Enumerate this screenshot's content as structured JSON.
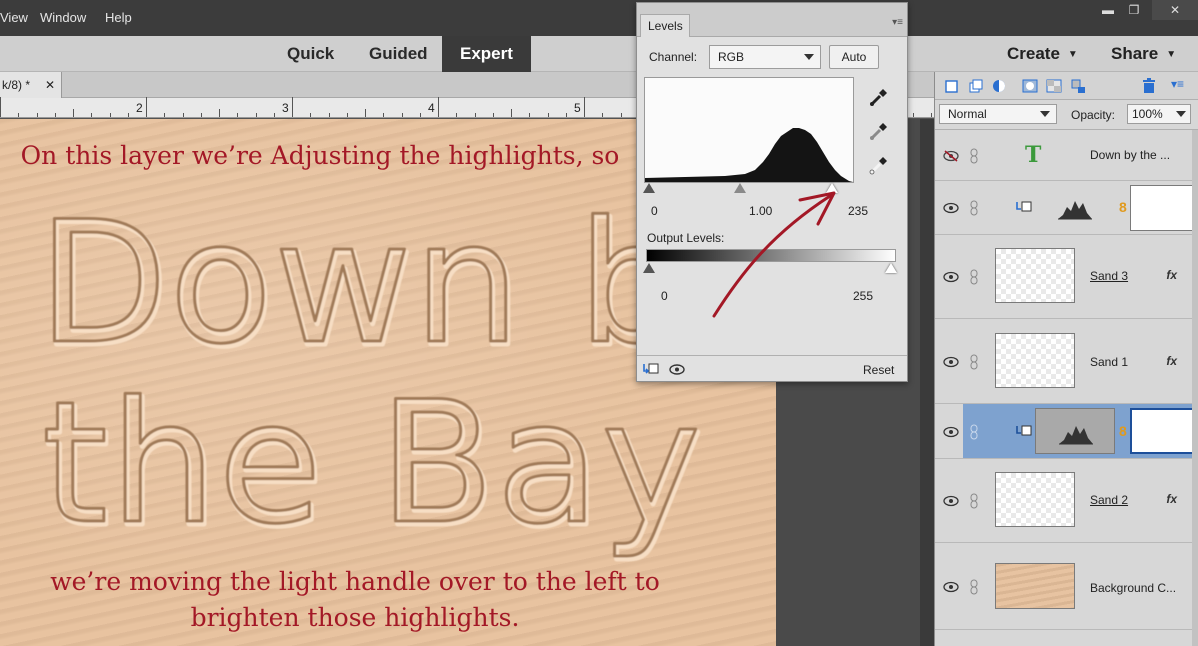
{
  "menu": {
    "items": [
      "View",
      "Window",
      "Help"
    ]
  },
  "window_controls": {
    "minimize": "▬",
    "restore": "❐",
    "close": "✕"
  },
  "modes": {
    "quick": "Quick",
    "guided": "Guided",
    "expert": "Expert"
  },
  "top_actions": {
    "create": "Create",
    "share": "Share"
  },
  "document": {
    "tab_title": "k/8) *",
    "close": "✕"
  },
  "ruler": {
    "labels": [
      "2",
      "3",
      "4",
      "5"
    ]
  },
  "canvas": {
    "caption_top": "On this layer we’re Adjusting the highlights, so",
    "caption_bottom_1": "we’re moving the light handle over to the left to",
    "caption_bottom_2": "brighten those highlights.",
    "sand_text_1": "Down by",
    "sand_text_2": "the Bay"
  },
  "levels": {
    "tab": "Levels",
    "channel_label": "Channel:",
    "channel_value": "RGB",
    "auto": "Auto",
    "input_black": "0",
    "input_gamma": "1.00",
    "input_white": "235",
    "output_label": "Output Levels:",
    "output_black": "0",
    "output_white": "255",
    "reset": "Reset"
  },
  "layers_panel": {
    "blend_mode": "Normal",
    "opacity_label": "Opacity:",
    "opacity_value": "100%",
    "layers": [
      {
        "name": "Down by the ...",
        "kind": "text"
      },
      {
        "name": "",
        "kind": "adjustment"
      },
      {
        "name": "Sand 3",
        "kind": "pixel",
        "fx": "fx"
      },
      {
        "name": "Sand 1",
        "kind": "pixel",
        "fx": "fx"
      },
      {
        "name": "",
        "kind": "adjustment-selected"
      },
      {
        "name": "Sand 2",
        "kind": "pixel",
        "fx": "fx"
      },
      {
        "name": "Background C...",
        "kind": "background"
      }
    ]
  },
  "colors": {
    "caption": "#a31826",
    "sand": "#e7c19d",
    "selection": "#7ea2cf"
  }
}
